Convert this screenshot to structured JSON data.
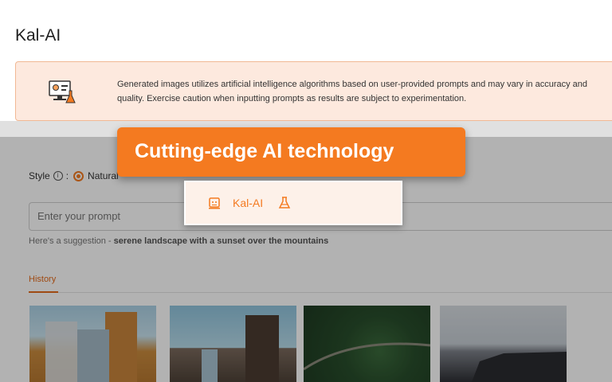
{
  "app": {
    "title": "Kal-AI"
  },
  "notice": {
    "icon": "computer-flask-icon",
    "text": "Generated images utilizes artificial intelligence algorithms based on user-provided prompts and may vary in accuracy and quality. Exercise caution when inputting prompts as results are subject to experimentation."
  },
  "style": {
    "label": "Style",
    "selected_option": "Natural"
  },
  "prompt": {
    "placeholder": "Enter your prompt",
    "suggestion_prefix": "Here's a suggestion - ",
    "suggestion_text": "serene landscape with a sunset over the mountains"
  },
  "history": {
    "tab_label": "History",
    "thumbnails": [
      "city-buildings-image",
      "office-tower-image",
      "forest-road-image",
      "car-image"
    ]
  },
  "callout": {
    "text": "Cutting-edge AI technology"
  },
  "popup": {
    "label": "Kal-AI",
    "icons": [
      "bot-icon",
      "flask-icon"
    ]
  },
  "colors": {
    "accent": "#f47a20",
    "notice_bg": "#fde9de",
    "notice_border": "#f1b894"
  }
}
